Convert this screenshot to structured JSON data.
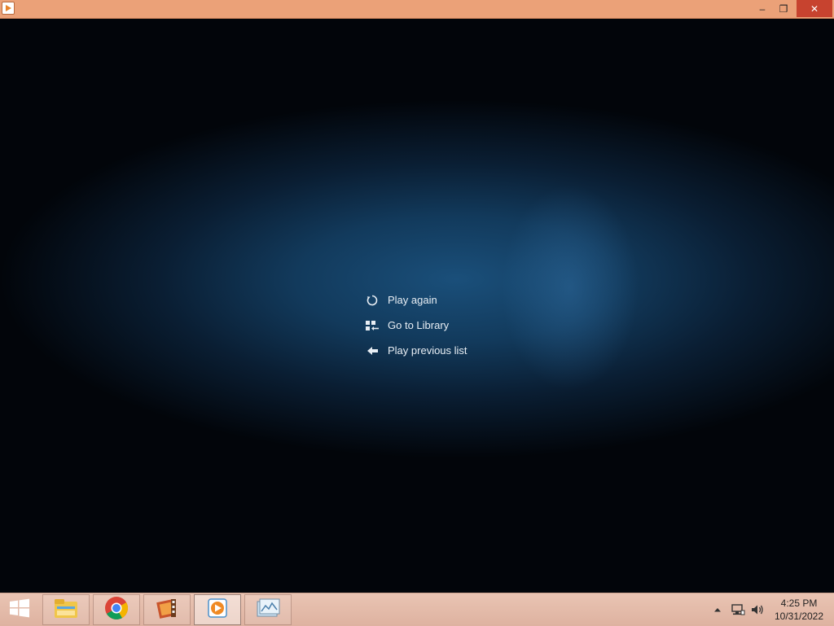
{
  "window": {
    "app_icon": "media-player-icon",
    "controls": {
      "minimize": "–",
      "maximize": "❐",
      "close": "✕"
    }
  },
  "menu": {
    "items": [
      {
        "label": "Play again",
        "icon": "replay-icon"
      },
      {
        "label": "Go to Library",
        "icon": "library-icon"
      },
      {
        "label": "Play previous list",
        "icon": "back-arrow-icon"
      }
    ]
  },
  "taskbar": {
    "pinned": [
      {
        "name": "start",
        "icon": "windows-logo-icon"
      },
      {
        "name": "file-explorer",
        "icon": "folder-icon"
      },
      {
        "name": "chrome",
        "icon": "chrome-icon"
      },
      {
        "name": "movie-maker",
        "icon": "film-icon"
      },
      {
        "name": "media-player",
        "icon": "media-player-icon",
        "active": true
      },
      {
        "name": "photo-gallery",
        "icon": "photo-gallery-icon"
      }
    ],
    "tray": {
      "icons": [
        "show-hidden-icons-icon",
        "network-icon",
        "volume-icon"
      ],
      "time": "4:25 PM",
      "date": "10/31/2022"
    }
  },
  "colors": {
    "titlebar": "#eba178",
    "close_button": "#c7432f",
    "taskbar": "#e3bba8",
    "menu_text": "#e8eef4"
  }
}
